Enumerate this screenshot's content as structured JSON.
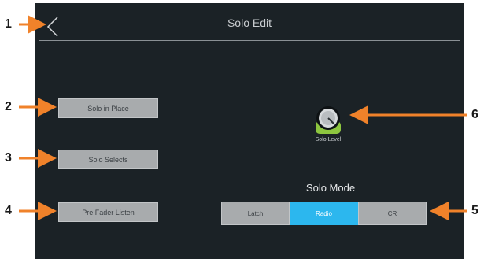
{
  "header": {
    "title": "Solo Edit"
  },
  "buttons": {
    "solo_in_place": "Solo in Place",
    "solo_selects": "Solo Selects",
    "pre_fader_listen": "Pre Fader Listen"
  },
  "knob": {
    "label": "Solo Level"
  },
  "solo_mode": {
    "title": "Solo Mode",
    "options": [
      "Latch",
      "Radio",
      "CR"
    ],
    "selected": "Radio"
  },
  "callouts": [
    "1",
    "2",
    "3",
    "4",
    "5",
    "6"
  ],
  "colors": {
    "screen_bg": "#1b2226",
    "button_gray": "#a8abad",
    "accent_blue": "#2cb7ee",
    "knob_green": "#8dc63f",
    "arrow_orange": "#f0822a"
  }
}
